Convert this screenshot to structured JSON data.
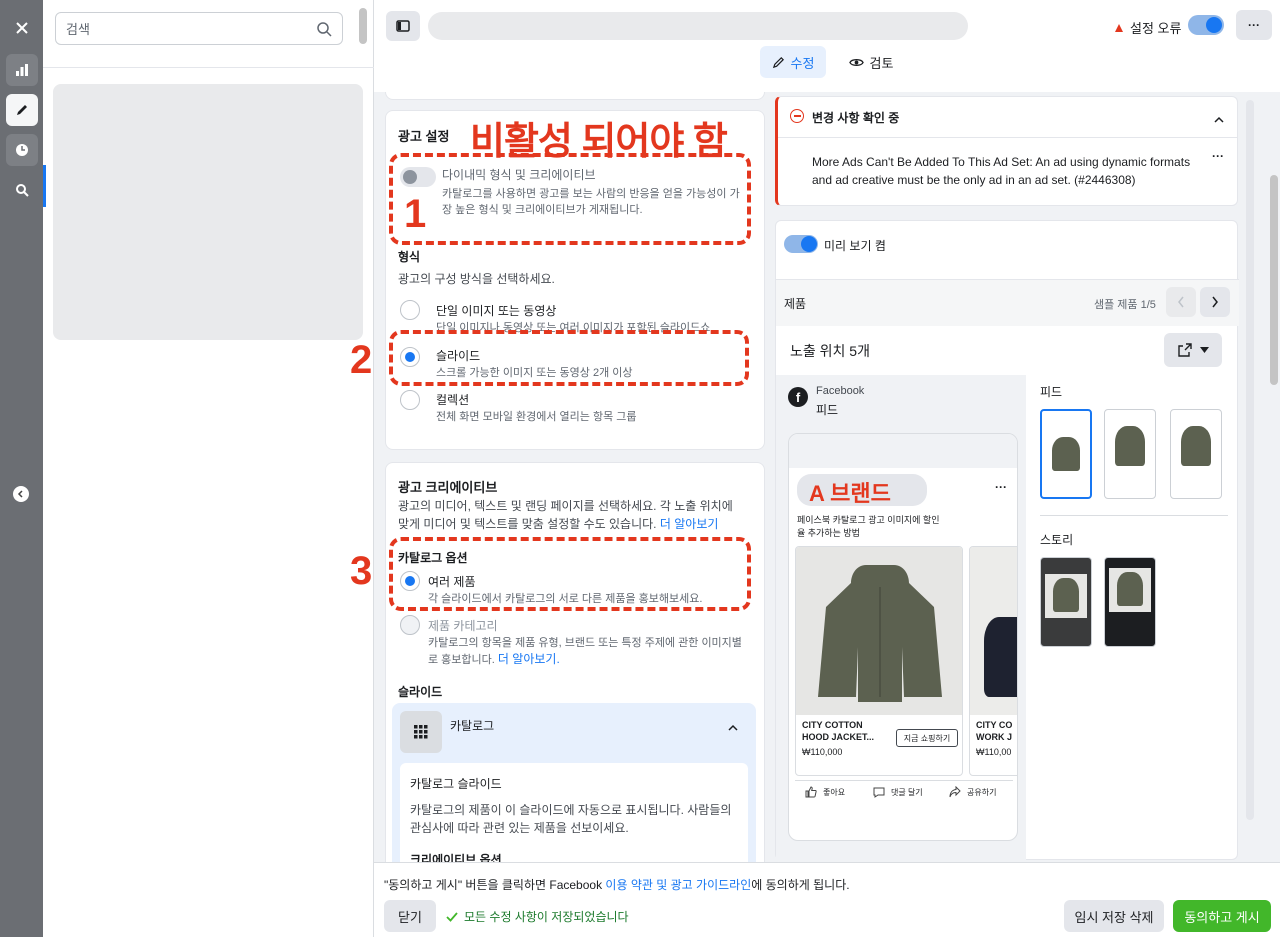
{
  "search": {
    "placeholder": "검색"
  },
  "header": {
    "error_label": "설정 오류",
    "tab_edit": "수정",
    "tab_review": "검토"
  },
  "ad_settings": {
    "title": "광고 설정",
    "dynamic_label": "다이내믹 형식 및 크리에이티브",
    "dynamic_desc": "카탈로그를 사용하면 광고를 보는 사람의 반응을 얻을 가능성이 가장 높은 형식 및 크리에이티브가 게재됩니다.",
    "format_title": "형식",
    "format_desc": "광고의 구성 방식을 선택하세요.",
    "options": [
      {
        "label": "단일 이미지 또는 동영상",
        "desc": "단일 이미지나 동영상 또는 여러 이미지가 포함된 슬라이드쇼"
      },
      {
        "label": "슬라이드",
        "desc": "스크롤 가능한 이미지 또는 동영상 2개 이상"
      },
      {
        "label": "컬렉션",
        "desc": "전체 화면 모바일 환경에서 열리는 항목 그룹"
      }
    ]
  },
  "creative": {
    "title": "광고 크리에이티브",
    "desc": "광고의 미디어, 텍스트 및 랜딩 페이지를 선택하세요. 각 노출 위치에 맞게 미디어 및 텍스트를 맞춤 설정할 수도 있습니다.",
    "learn_more": "더 알아보기",
    "catalog_title": "카탈로그 옵션",
    "multi_label": "여러 제품",
    "multi_desc": "각 슬라이드에서 카탈로그의 서로 다른 제품을 홍보해보세요.",
    "category_label": "제품 카테고리",
    "category_desc": "카탈로그의 항목을 제품 유형, 브랜드 또는 특정 주제에 관한 이미지별로 홍보합니다.",
    "learn_more2": "더 알아보기.",
    "slides_title": "슬라이드",
    "catalog_label": "카탈로그",
    "catalog_slide_title": "카탈로그 슬라이드",
    "catalog_slide_desc": "카탈로그의 제품이 이 슬라이드에 자동으로 표시됩니다. 사람들의 관심사에 따라 관련 있는 제품을 선보이세요.",
    "creative_options": "크리에이티브 옵션"
  },
  "annotations": {
    "title": "비활성 되어야 함",
    "n1": "1",
    "n2": "2",
    "n3": "3",
    "brand": "A 브랜드"
  },
  "alert": {
    "title": "변경 사항 확인 중",
    "message": "More Ads Can't Be Added To This Ad Set: An ad using dynamic formats and ad creative must be the only ad in an ad set. (#2446308)"
  },
  "preview": {
    "toggle_label": "미리 보기 켬",
    "product_label": "제품",
    "sample_label": "샘플 제품 1/5",
    "placements_title": "노출 위치 5개",
    "platform": "Facebook",
    "placement": "피드",
    "ad_text": "페이스북 카탈로그 광고 이미지에 할인율 추가하는 방법",
    "cards": [
      {
        "name": "CITY COTTON HOOD JACKET...",
        "price": "₩110,000",
        "cta": "지금 쇼핑하기"
      },
      {
        "name": "CITY CO WORK J",
        "price": "₩110,00"
      }
    ],
    "actions": [
      "좋아요",
      "댓글 달기",
      "공유하기"
    ],
    "feed_label": "피드",
    "story_label": "스토리"
  },
  "footer": {
    "terms_prefix": "\"동의하고 게시\" 버튼을 클릭하면 Facebook",
    "terms_link": "이용 약관 및 광고 가이드라인",
    "terms_suffix": "에 동의하게 됩니다.",
    "close": "닫기",
    "saved": "모든 수정 사항이 저장되었습니다",
    "delete_draft": "임시 저장 삭제",
    "publish": "동의하고 게시"
  },
  "colors": {
    "accent": "#1877f2",
    "green": "#42b72a",
    "annotation": "#e3371e"
  }
}
